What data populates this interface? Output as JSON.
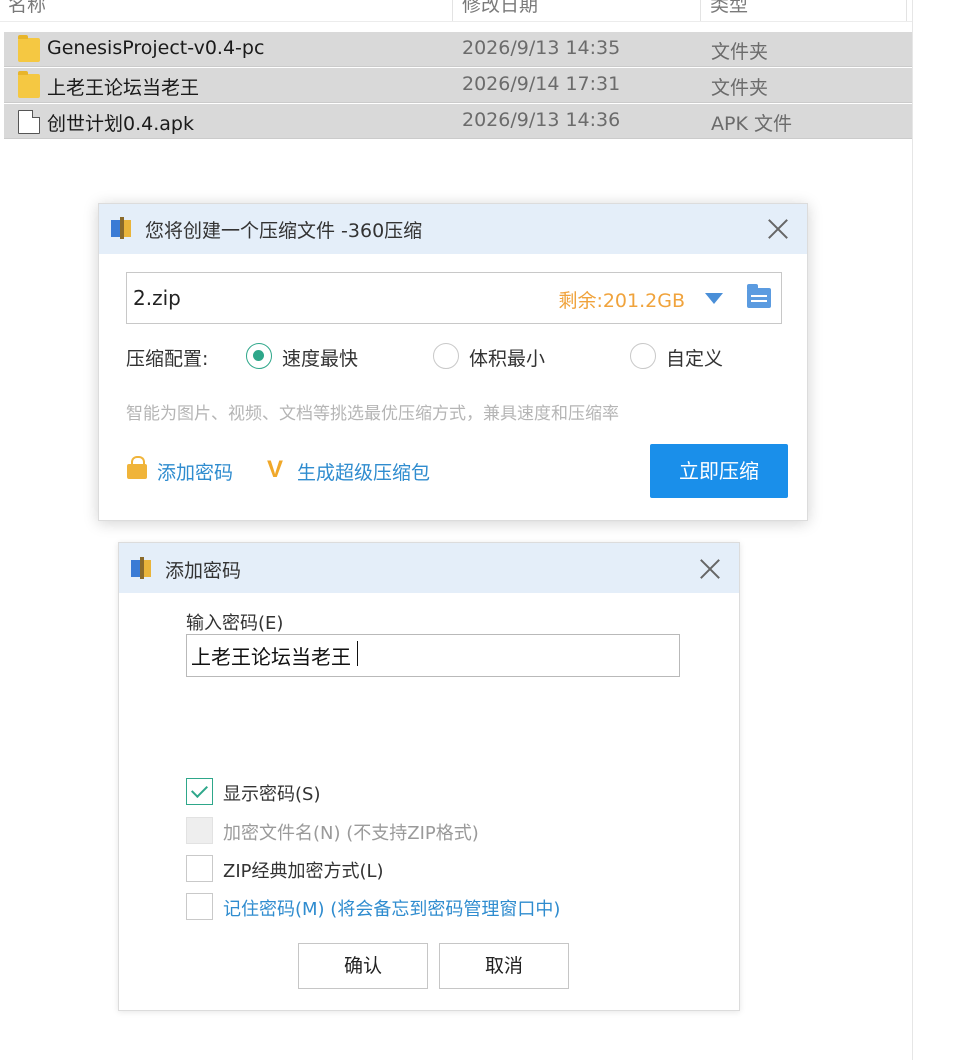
{
  "explorer": {
    "headers": {
      "name": "名称",
      "date": "修改日期",
      "type": "类型"
    },
    "files": [
      {
        "name": "GenesisProject-v0.4-pc",
        "date": "2026/9/13 14:35",
        "type": "文件夹",
        "icon": "folder-icon"
      },
      {
        "name": "上老王论坛当老王",
        "date": "2026/9/14 17:31",
        "type": "文件夹",
        "icon": "folder-icon"
      },
      {
        "name": "创世计划0.4.apk",
        "date": "2026/9/13 14:36",
        "type": "APK 文件",
        "icon": "file-icon"
      }
    ]
  },
  "compress_dialog": {
    "title": "您将创建一个压缩文件 -360压缩",
    "filename": "2.zip",
    "remaining": "剩余:201.2GB",
    "config_label": "压缩配置:",
    "options": [
      "速度最快",
      "体积最小",
      "自定义"
    ],
    "selected_option": "速度最快",
    "hint": "智能为图片、视频、文档等挑选最优压缩方式，兼具速度和压缩率",
    "add_password": "添加密码",
    "super_package": "生成超级压缩包",
    "compress_now": "立即压缩",
    "colors": {
      "accent": "#1a8fea",
      "link": "#2f8ccf",
      "remaining": "#f0a33c",
      "radio": "#2ea78a"
    }
  },
  "password_dialog": {
    "title": "添加密码",
    "input_label": "输入密码(E)",
    "password_value": "上老王论坛当老王",
    "checkboxes": [
      {
        "label": "显示密码(S)",
        "checked": true,
        "disabled": false
      },
      {
        "label": "加密文件名(N) (不支持ZIP格式)",
        "checked": false,
        "disabled": true
      },
      {
        "label": "ZIP经典加密方式(L)",
        "checked": false,
        "disabled": false
      },
      {
        "label": "记住密码(M) (将会备忘到密码管理窗口中)",
        "checked": false,
        "disabled": false
      }
    ],
    "ok": "确认",
    "cancel": "取消"
  }
}
